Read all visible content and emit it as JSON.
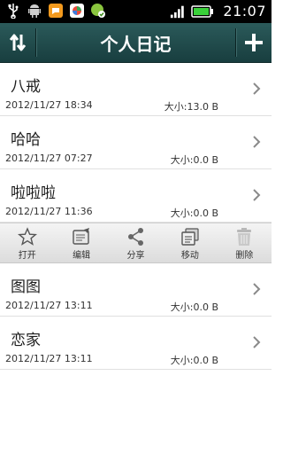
{
  "status_bar": {
    "time": "21:07",
    "left_icons": [
      "usb-icon",
      "android-debug-icon",
      "chat-icon",
      "photo-app-icon",
      "sync-icon"
    ],
    "right_icons": [
      "signal-icon",
      "battery-icon"
    ]
  },
  "header": {
    "title": "个人日记",
    "left_icon": "sort-icon",
    "right_icon": "add-icon"
  },
  "entries": [
    {
      "title": "八戒",
      "date": "2012/11/27 18:34",
      "size": "大小:13.0 B"
    },
    {
      "title": "哈哈",
      "date": "2012/11/27 07:27",
      "size": "大小:0.0 B"
    },
    {
      "title": "啦啦啦",
      "date": "2012/11/27 11:36",
      "size": "大小:0.0 B"
    },
    {
      "title": "图图",
      "date": "2012/11/27 13:11",
      "size": "大小:0.0 B"
    },
    {
      "title": "恋家",
      "date": "2012/11/27 13:11",
      "size": "大小:0.0 B"
    }
  ],
  "actions": [
    {
      "label": "打开",
      "icon": "star-icon"
    },
    {
      "label": "编辑",
      "icon": "edit-icon"
    },
    {
      "label": "分享",
      "icon": "share-icon"
    },
    {
      "label": "移动",
      "icon": "move-icon"
    },
    {
      "label": "删除",
      "icon": "trash-icon"
    }
  ],
  "colors": {
    "titlebar": "#1f4a4a",
    "background": "#ffffff",
    "status_bar": "#000000"
  }
}
